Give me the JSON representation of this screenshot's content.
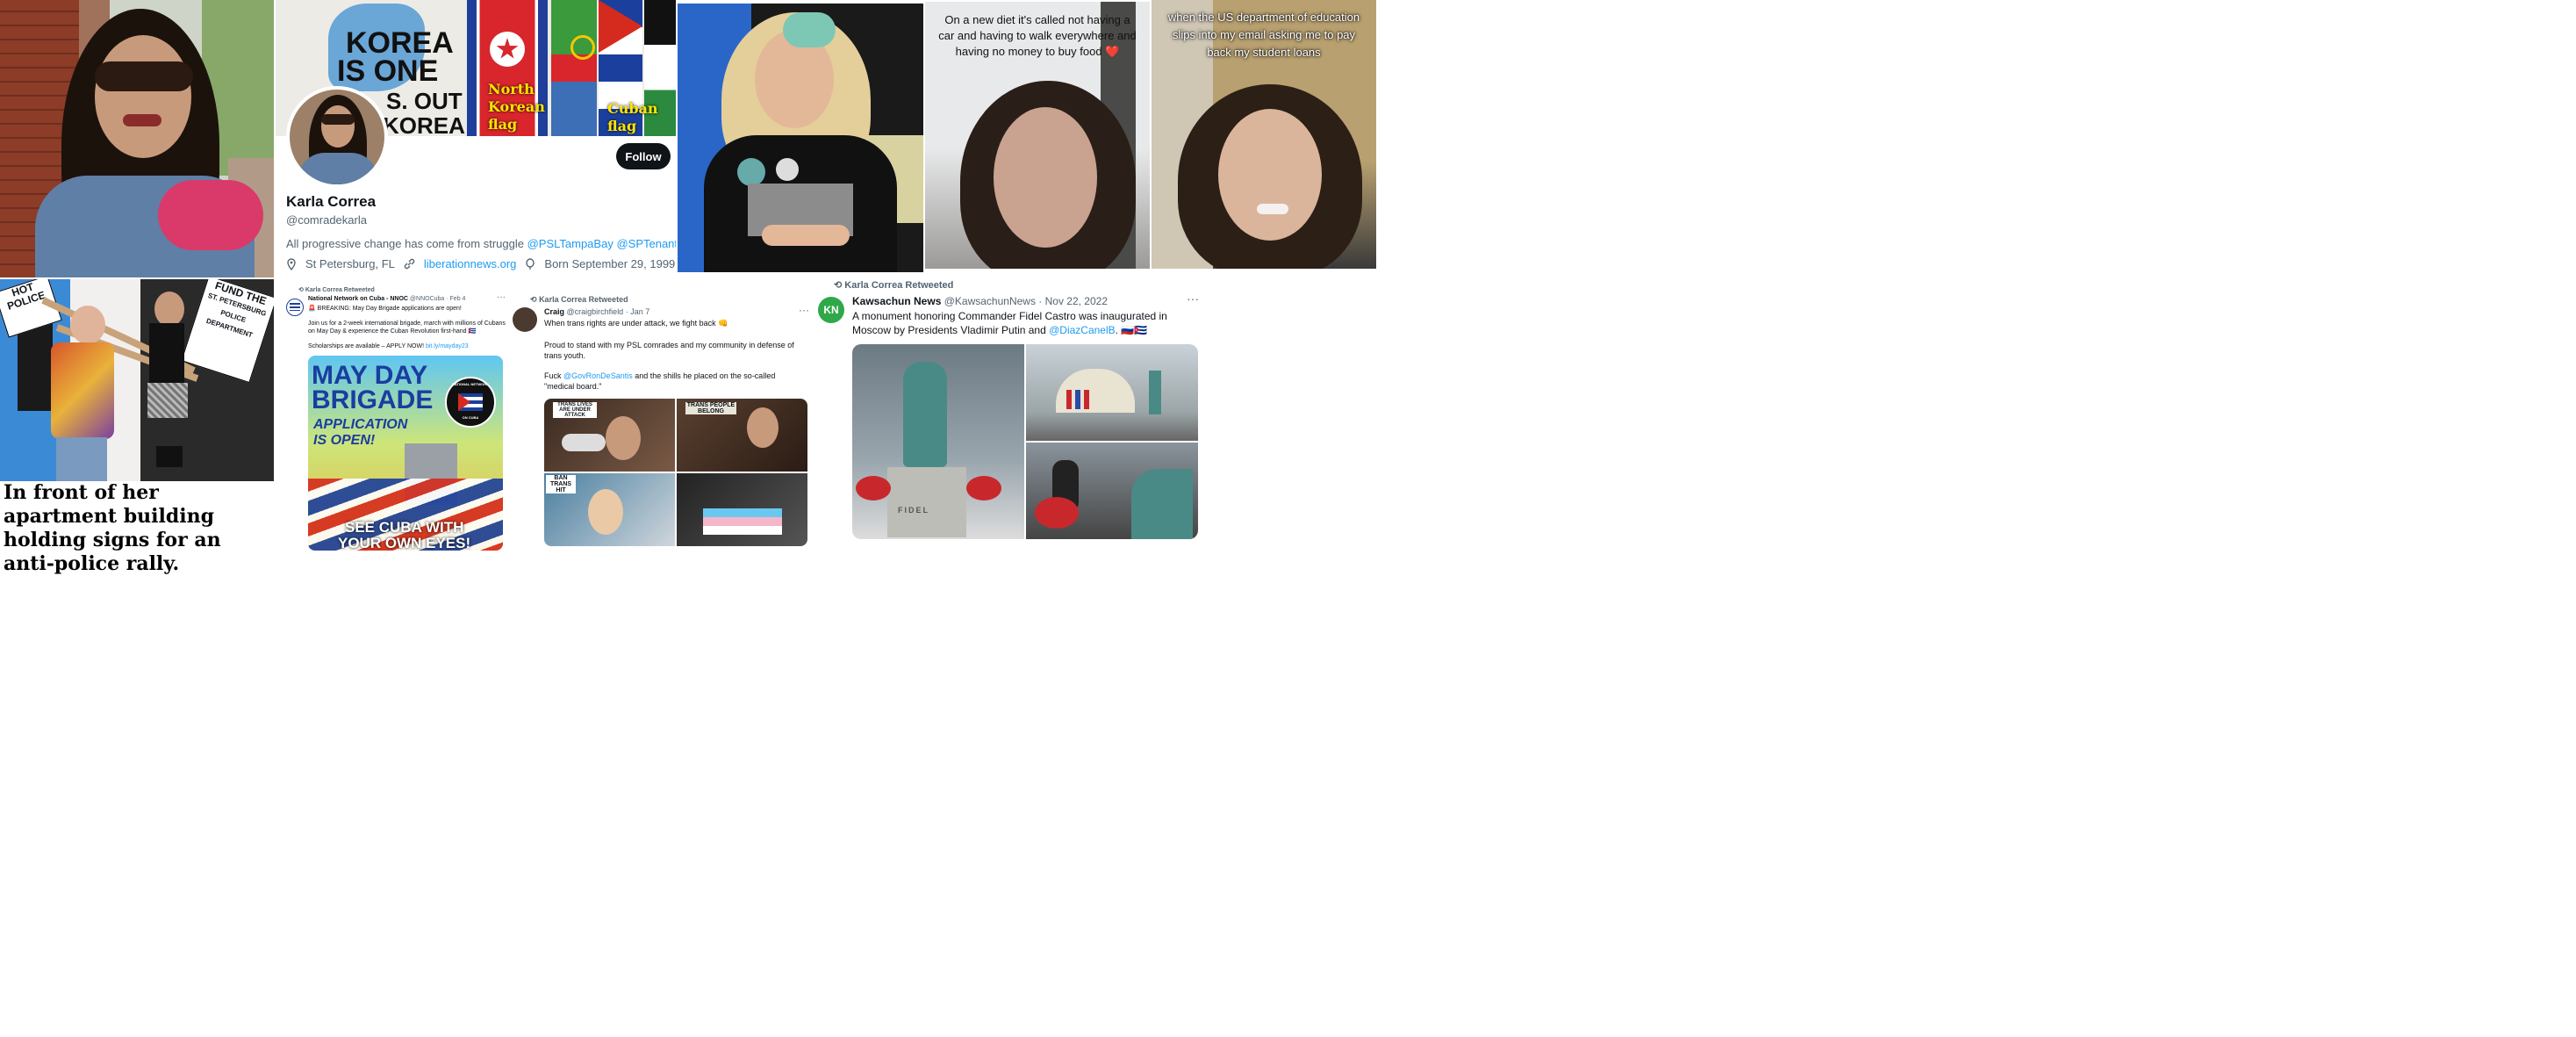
{
  "profile": {
    "banner_text_line1": "KOREA",
    "banner_text_line2": "IS ONE",
    "banner_text_line3": "S. OUT",
    "banner_text_line4": "KOREA!",
    "flag_label_nk": "North Korean flag",
    "flag_label_cuba": "Cuban flag",
    "name": "Karla Correa",
    "handle": "@comradekarla",
    "follow_label": "Follow",
    "bio_text": "All progressive change has come from struggle",
    "bio_link1": "@PSLTampaBay",
    "bio_link2": "@SPTenantsU",
    "location": "St Petersburg, FL",
    "website": "liberationnews.org",
    "birthday": "Born September 29, 1999",
    "icons": [
      "location-icon",
      "link-icon",
      "balloon-icon"
    ]
  },
  "tiktok1": {
    "overlay": "On a new diet it's called not having a car and having to walk everywhere and having no money to buy food",
    "emoji": "❤️"
  },
  "tiktok2": {
    "overlay": "when the US department of education slips into my email asking me to pay back my student loans"
  },
  "rally": {
    "sign1": "FUND THE",
    "sign2": "POLICE",
    "sign3": "HOT",
    "sign4": "THE",
    "sign5": "ST. PETERSBURG",
    "sign6": "POLICE DEPARTMENT",
    "caption": "In front of her apartment building holding signs for an anti-police rally."
  },
  "tweet1": {
    "retweet": "Karla Correa Retweeted",
    "author": "National Network on Cuba - NNOC",
    "handle_date": "@NNOCuba · Feb 4",
    "line1": "🚨 BREAKING: May Day Brigade applications are open!",
    "line2": "Join us for a 2-week international brigade, march with millions of Cubans on May Day & experience the Cuban Revolution first-hand 🇨🇺",
    "line3": "Scholarships are available – APPLY NOW!",
    "link": "bit.ly/mayday23",
    "poster_title1": "MAY DAY",
    "poster_title2": "BRIGADE",
    "poster_sub1": "APPLICATION",
    "poster_sub2": "IS OPEN!",
    "seal_text_top": "NATIONAL NETWORK",
    "seal_text_bottom": "ON CUBA",
    "poster_bottom1": "SEE CUBA WITH",
    "poster_bottom2": "YOUR OWN EYES!"
  },
  "tweet2": {
    "retweet": "Karla Correa Retweeted",
    "author": "Craig",
    "handle_date": "@craigbirchfield · Jan 7",
    "line1": "When trans rights are under attack, we fight back 👊",
    "line2": "Proud to stand with my PSL comrades and my community in defense of trans youth.",
    "line3_pre": "Fuck",
    "line3_link": "@GovRonDeSantis",
    "line3_post": "and the shills he placed on the so-called \"medical board.\"",
    "sign_a": "TRANS LIVES ARE UNDER ATTACK",
    "sign_b": "TRANS PEOPLE BELONG",
    "sign_c": "BAN TRANS HIT"
  },
  "tweet3": {
    "retweet": "Karla Correa Retweeted",
    "avatar_text": "KN",
    "author": "Kawsachun News",
    "handle_date": "@KawsachunNews · Nov 22, 2022",
    "line1": "A monument honoring Commander Fidel Castro was inaugurated in",
    "line2_pre": "Moscow by Presidents Vladimir Putin and",
    "line2_link": "@DiazCanelB",
    "line2_post": ". 🇷🇺🇨🇺",
    "plaque": "FIDEL"
  },
  "colors": {
    "twitter_blue": "#1d9bf0",
    "flag_label_yellow": "#ffe500",
    "cuba_red": "#d52b1e",
    "cuba_blue": "#002a8f"
  }
}
